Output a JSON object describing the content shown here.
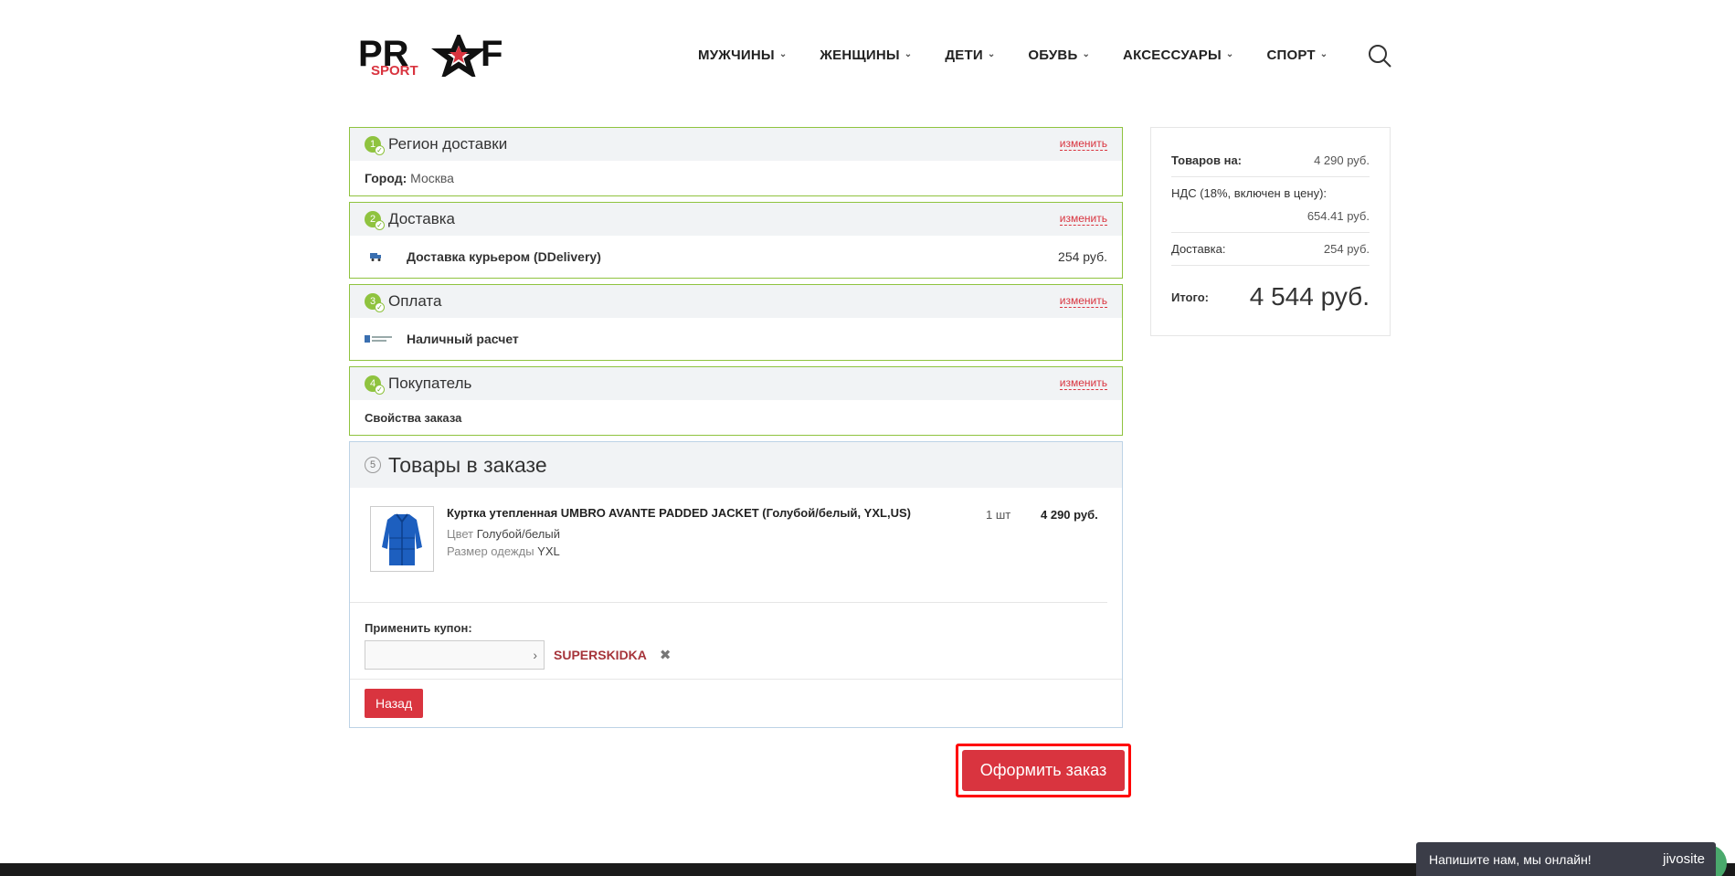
{
  "header": {
    "logo_text": "PROF SPORT",
    "nav": [
      {
        "label": "МУЖЧИНЫ"
      },
      {
        "label": "ЖЕНЩИНЫ"
      },
      {
        "label": "ДЕТИ"
      },
      {
        "label": "ОБУВЬ"
      },
      {
        "label": "АКСЕССУАРЫ"
      },
      {
        "label": "СПОРТ"
      }
    ]
  },
  "sections": {
    "region": {
      "step": "1",
      "title": "Регион доставки",
      "change": "изменить",
      "city_label": "Город:",
      "city_value": "Москва"
    },
    "delivery": {
      "step": "2",
      "title": "Доставка",
      "change": "изменить",
      "method": "Доставка курьером (DDelivery)",
      "price": "254 руб."
    },
    "payment": {
      "step": "3",
      "title": "Оплата",
      "change": "изменить",
      "method": "Наличный расчет"
    },
    "buyer": {
      "step": "4",
      "title": "Покупатель",
      "change": "изменить",
      "props_label": "Свойства заказа"
    },
    "order": {
      "step": "5",
      "title": "Товары в заказе",
      "item": {
        "name": "Куртка утепленная UMBRO AVANTE PADDED JACKET (Голубой/белый, YXL,US)",
        "color_label": "Цвет",
        "color_value": "Голубой/белый",
        "size_label": "Размер одежды",
        "size_value": "YXL",
        "qty": "1 шт",
        "price": "4 290 руб."
      },
      "coupon_label": "Применить купон:",
      "coupon_placeholder": "",
      "coupon_code": "SUPERSKIDKA",
      "back_button": "Назад"
    }
  },
  "submit_button": "Оформить заказ",
  "summary": {
    "goods_label": "Товаров на:",
    "goods_value": "4 290 руб.",
    "nds_label": "НДС (18%, включен в цену):",
    "nds_value": "654.41 руб.",
    "delivery_label": "Доставка:",
    "delivery_value": "254 руб.",
    "total_label": "Итого:",
    "total_value": "4 544 руб."
  },
  "chat": {
    "text": "Напишите нам, мы онлайн!",
    "brand": "jivosite"
  },
  "colors": {
    "accent_red": "#d9343f",
    "step_green": "#8fc33f"
  }
}
